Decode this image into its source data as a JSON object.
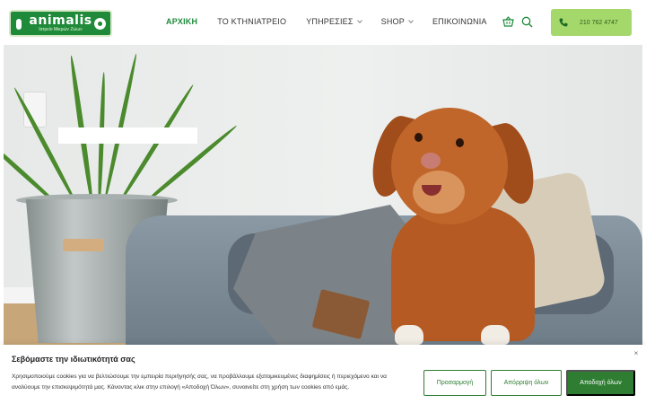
{
  "header": {
    "logo": {
      "word": "animalis",
      "tagline": "Ιατρείο Μικρών Ζώων"
    },
    "nav": [
      {
        "label": "ΑΡΧΙΚΗ",
        "active": true,
        "has_dropdown": false
      },
      {
        "label": "ΤΟ ΚΤΗΝΙΑΤΡΕΙΟ",
        "active": false,
        "has_dropdown": false
      },
      {
        "label": "ΥΠΗΡΕΣΙΕΣ",
        "active": false,
        "has_dropdown": true
      },
      {
        "label": "SHOP",
        "active": false,
        "has_dropdown": true
      },
      {
        "label": "ΕΠΙΚΟΙΝΩΝΙΑ",
        "active": false,
        "has_dropdown": false
      }
    ],
    "icons": {
      "cart": "basket-icon",
      "search": "search-icon"
    },
    "phone": {
      "number": "210 762 4747",
      "icon": "phone-icon"
    }
  },
  "hero": {
    "image": "dog-on-bed-photo"
  },
  "cookie_bar": {
    "title": "Σεβόμαστε την ιδιωτικότητά σας",
    "text": "Χρησιμοποιούμε cookies για να βελτιώσουμε την εμπειρία περιήγησής σας, να προβάλλουμε εξατομικευμένες διαφημίσεις ή περιεχόμενο και να αναλύουμε την επισκεψιμότητά μας. Κάνοντας κλικ στην επιλογή «Αποδοχή Όλων», συναινείτε στη χρήση των cookies από εμάς.",
    "close": "×",
    "buttons": {
      "customize": "Προσαρμογή",
      "reject": "Απόρριψη όλων",
      "accept": "Αποδοχή όλων"
    }
  },
  "colors": {
    "brand_green": "#1f8a3a",
    "button_green": "#2e7d32",
    "phone_bg": "#a5d86b"
  }
}
